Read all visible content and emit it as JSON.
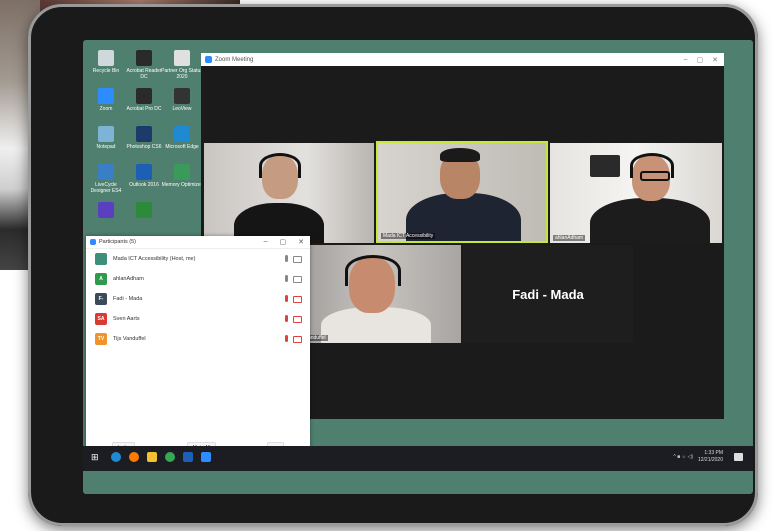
{
  "desktop": {
    "icons": [
      {
        "label": "Recycle Bin",
        "color": "#cfd8dc"
      },
      {
        "label": "Acrobat Reader DC",
        "color": "#2a2a2a"
      },
      {
        "label": "Partner Org Status 2020",
        "color": "#e0e0e0"
      },
      {
        "label": "Zoom",
        "color": "#2d8cff"
      },
      {
        "label": "Acrobat Pro DC",
        "color": "#2a2a2a"
      },
      {
        "label": "LeoView",
        "color": "#333333"
      },
      {
        "label": "Notepad",
        "color": "#7fb3d5"
      },
      {
        "label": "Photoshop CS6",
        "color": "#1d3a6b"
      },
      {
        "label": "Microsoft Edge",
        "color": "#1f8ad1"
      },
      {
        "label": "LiveCycle Designer ES4",
        "color": "#3a7ec7"
      },
      {
        "label": "Outlook 2016",
        "color": "#1d5fb5"
      },
      {
        "label": "Memory Optimizer",
        "color": "#3a9a5a"
      },
      {
        "label": "",
        "color": "#5b3fc1"
      },
      {
        "label": "",
        "color": "#2d8a3a"
      }
    ]
  },
  "zoom_window": {
    "title": "Zoom Meeting",
    "tiles": [
      {
        "name": ""
      },
      {
        "name": "Mada ICT Accessibility"
      },
      {
        "name": "ahlanAdham"
      },
      {
        "name": "Tijs Vanduffel"
      },
      {
        "name": "Fadi - Mada"
      }
    ]
  },
  "participants": {
    "title": "Participants (5)",
    "rows": [
      {
        "initials": "",
        "name": "Mada ICT Accessibility (Host, me)",
        "color": "#3e8f7a",
        "muted": false
      },
      {
        "initials": "A",
        "name": "ahlanAdham",
        "color": "#2f9a4b",
        "muted": false
      },
      {
        "initials": "F-",
        "name": "Fadi - Mada",
        "color": "#3a4a5a",
        "muted": true
      },
      {
        "initials": "SA",
        "name": "Sven Aarts",
        "color": "#d93b2f",
        "muted": true
      },
      {
        "initials": "TV",
        "name": "Tijs Vanduffel",
        "color": "#f0932b",
        "muted": true
      }
    ],
    "invite_label": "Invite",
    "mute_all_label": "Mute All"
  },
  "taskbar": {
    "time": "1:33 PM",
    "date": "12/21/2020",
    "tray": "^ ■ ☼ ◁)"
  }
}
